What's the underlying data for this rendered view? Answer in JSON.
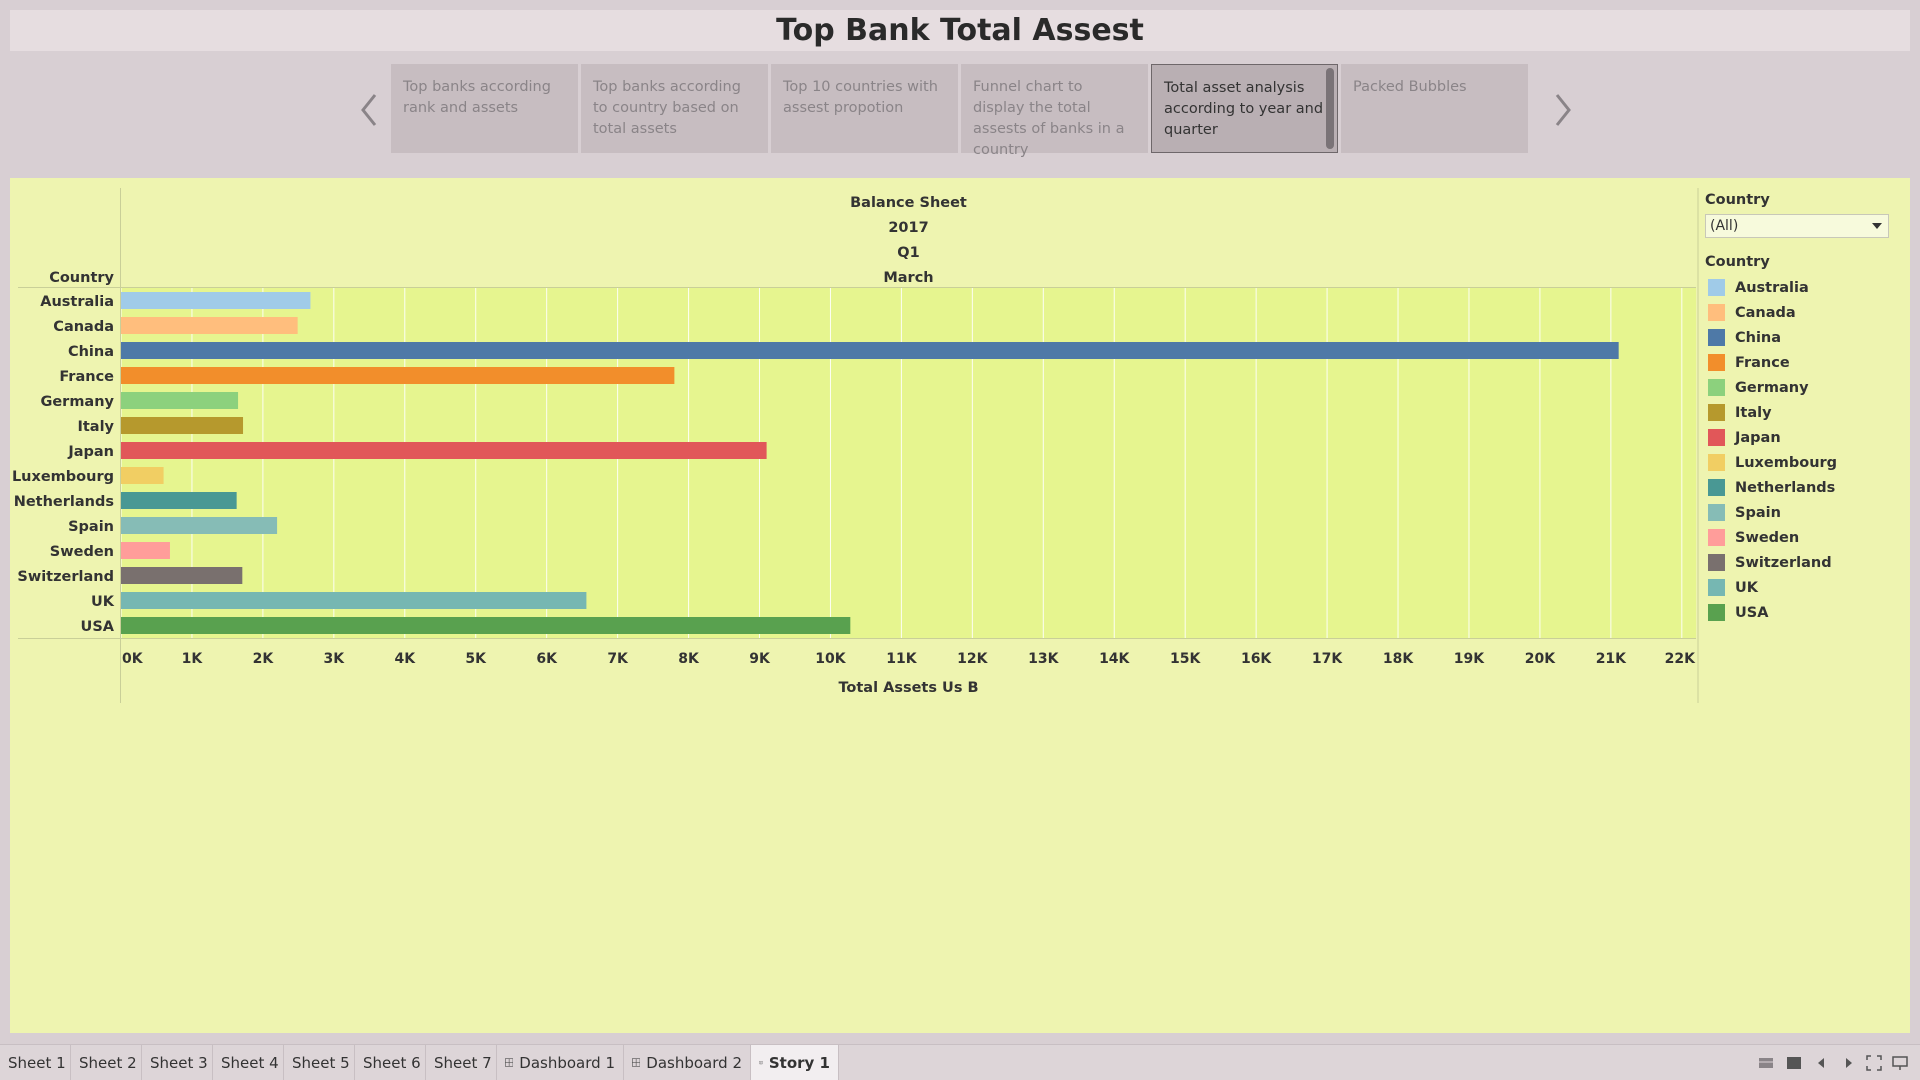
{
  "title": "Top Bank Total Assest",
  "story_points": [
    {
      "label": "Top banks according rank and assets"
    },
    {
      "label": "Top banks according to country based on total assets"
    },
    {
      "label": "Top 10 countries with assest propotion"
    },
    {
      "label": "Funnel chart to display the total assests of banks in a country"
    },
    {
      "label": "Total asset analysis according to year and quarter"
    },
    {
      "label": "Packed Bubbles"
    }
  ],
  "active_story_point": 4,
  "filter": {
    "title": "Country",
    "value": "(All)"
  },
  "legend": {
    "title": "Country"
  },
  "chart_data": {
    "type": "bar",
    "orientation": "horizontal",
    "column_headers": [
      "Balance Sheet",
      "2017",
      "Q1",
      "March"
    ],
    "row_header": "Country",
    "categories": [
      "Australia",
      "Canada",
      "China",
      "France",
      "Germany",
      "Italy",
      "Japan",
      "Luxembourg",
      "Netherlands",
      "Spain",
      "Sweden",
      "Switzerland",
      "UK",
      "USA"
    ],
    "values": [
      2670,
      2490,
      21110,
      7800,
      1650,
      1720,
      9100,
      600,
      1630,
      2200,
      690,
      1710,
      6560,
      10280
    ],
    "colors": [
      "#a0cbe8",
      "#ffbe7d",
      "#4e79a7",
      "#f28e2b",
      "#8cd17d",
      "#b6992d",
      "#e15759",
      "#f1ce63",
      "#499894",
      "#86bcb6",
      "#ff9d9a",
      "#79706e",
      "#76b7b2",
      "#59a14f"
    ],
    "xlabel": "Total Assets Us B",
    "xlim": [
      0,
      22200
    ],
    "x_ticks": [
      0,
      1000,
      2000,
      3000,
      4000,
      5000,
      6000,
      7000,
      8000,
      9000,
      10000,
      11000,
      12000,
      13000,
      14000,
      15000,
      16000,
      17000,
      18000,
      19000,
      20000,
      21000,
      22000
    ],
    "x_tick_labels": [
      "0K",
      "1K",
      "2K",
      "3K",
      "4K",
      "5K",
      "6K",
      "7K",
      "8K",
      "9K",
      "10K",
      "11K",
      "12K",
      "13K",
      "14K",
      "15K",
      "16K",
      "17K",
      "18K",
      "19K",
      "20K",
      "21K",
      "22K"
    ],
    "grid": true,
    "legend_position": "right"
  },
  "sheet_tabs": [
    {
      "label": "Sheet 1",
      "icon": ""
    },
    {
      "label": "Sheet 2",
      "icon": ""
    },
    {
      "label": "Sheet 3",
      "icon": ""
    },
    {
      "label": "Sheet 4",
      "icon": ""
    },
    {
      "label": "Sheet 5",
      "icon": ""
    },
    {
      "label": "Sheet 6",
      "icon": ""
    },
    {
      "label": "Sheet 7",
      "icon": ""
    },
    {
      "label": "Dashboard 1",
      "icon": "dashboard-icon"
    },
    {
      "label": "Dashboard 2",
      "icon": "dashboard-icon"
    },
    {
      "label": "Story 1",
      "icon": "story-icon"
    }
  ],
  "active_tab": 9,
  "colors": {
    "panel_background": "#eef4b0",
    "plot_background": "#e6f58f",
    "page_background": "#d8cfd3"
  }
}
